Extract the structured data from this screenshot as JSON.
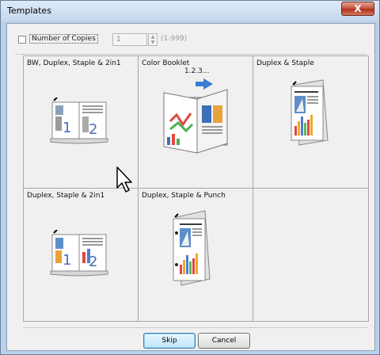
{
  "window": {
    "title": "Templates",
    "close_label": "X"
  },
  "copies": {
    "checkbox_label": "Number of Copies",
    "value": "1",
    "range": "(1-999)",
    "checked": false
  },
  "templates": [
    {
      "label": "BW, Duplex, Staple & 2in1"
    },
    {
      "label": "Color Booklet"
    },
    {
      "label": "Duplex & Staple"
    },
    {
      "label": "Duplex, Staple & 2in1"
    },
    {
      "label": "Duplex, Staple & Punch"
    },
    {
      "label": ""
    }
  ],
  "booklet_page_text": "1.2.3...",
  "buttons": {
    "skip": "Skip",
    "cancel": "Cancel"
  }
}
